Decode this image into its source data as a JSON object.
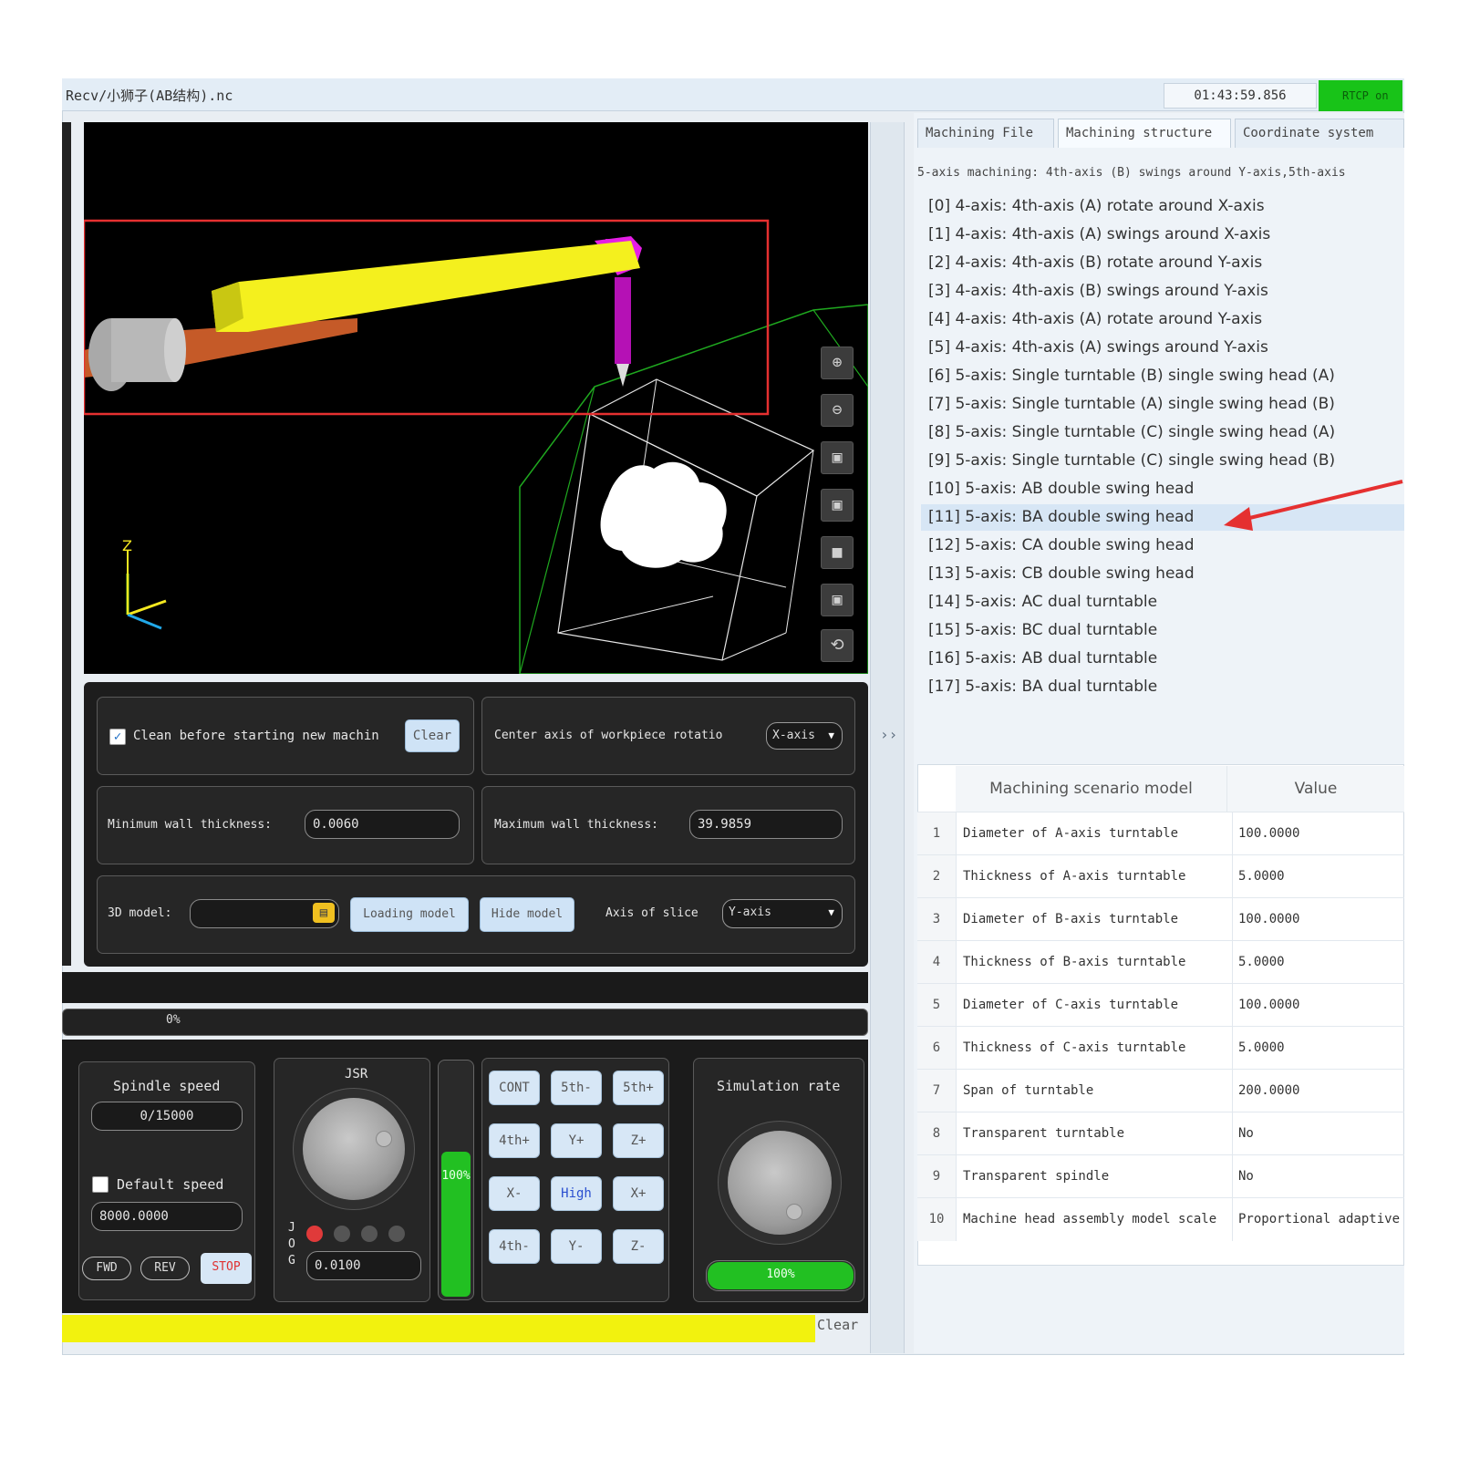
{
  "window": {
    "title": "Recv/小狮子(AB结构).nc",
    "timer": "01:43:59.856",
    "rtcp_label": "RTCP on"
  },
  "viewport": {
    "tools": [
      {
        "name": "zoom-in",
        "glyph": "⊕"
      },
      {
        "name": "zoom-out",
        "glyph": "⊖"
      },
      {
        "name": "view-iso",
        "glyph": "▣"
      },
      {
        "name": "view-front",
        "glyph": "▣"
      },
      {
        "name": "view-top",
        "glyph": "■"
      },
      {
        "name": "view-side",
        "glyph": "▣"
      },
      {
        "name": "reset-view",
        "glyph": "⟲"
      }
    ],
    "axis_label": "Z"
  },
  "controls": {
    "clean_checkbox_label": "Clean before starting new machin",
    "clean_checked": true,
    "clear_button": "Clear",
    "center_axis_label": "Center axis of workpiece rotatio",
    "center_axis_value": "X-axis",
    "min_wall_label": "Minimum wall thickness:",
    "min_wall_value": "0.0060",
    "max_wall_label": "Maximum wall thickness:",
    "max_wall_value": "39.9859",
    "model_label": "3D model:",
    "model_value": "",
    "loading_model_button": "Loading model",
    "hide_model_button": "Hide model",
    "slice_axis_label": "Axis of slice",
    "slice_axis_value": "Y-axis"
  },
  "progress": {
    "text": "0%",
    "value": 0
  },
  "spindle": {
    "title": "Spindle speed",
    "speed_value": "0/15000",
    "default_label": "Default speed",
    "default_checked": false,
    "default_value": "8000.0000",
    "fwd": "FWD",
    "rev": "REV",
    "stop": "STOP"
  },
  "jog": {
    "title": "JSR",
    "side_label_chars": [
      "J",
      "O",
      "G"
    ],
    "step_value": "0.0100",
    "feed_percent": "100%",
    "feed_level": 1.0,
    "leds": [
      "red",
      "gray",
      "gray",
      "gray"
    ]
  },
  "keypad": [
    [
      "CONT",
      "5th-",
      "5th+"
    ],
    [
      "4th+",
      "Y+",
      "Z+"
    ],
    [
      "X-",
      "High",
      "X+"
    ],
    [
      "4th-",
      "Y-",
      "Z-"
    ]
  ],
  "simulation": {
    "title": "Simulation rate",
    "rate": "100%",
    "rate_level": 1.0
  },
  "output": {
    "clear": "Clear"
  },
  "right_panel": {
    "tabs": [
      "Machining File",
      "Machining structure",
      "Coordinate system"
    ],
    "active_tab": 1,
    "description": "5-axis machining: 4th-axis (B) swings around Y-axis,5th-axis",
    "options": [
      "[0] 4-axis: 4th-axis (A) rotate around X-axis",
      "[1] 4-axis: 4th-axis (A) swings around X-axis",
      "[2] 4-axis: 4th-axis (B) rotate around Y-axis",
      "[3] 4-axis: 4th-axis (B) swings around Y-axis",
      "[4] 4-axis: 4th-axis (A) rotate around Y-axis",
      "[5] 4-axis: 4th-axis (A) swings around Y-axis",
      "[6] 5-axis: Single turntable (B) single swing head (A)",
      "[7] 5-axis: Single turntable (A) single swing head (B)",
      "[8] 5-axis: Single turntable (C) single swing head (A)",
      "[9] 5-axis: Single turntable (C) single swing head (B)",
      "[10] 5-axis: AB double swing head",
      "[11] 5-axis: BA double swing head",
      "[12] 5-axis: CA double swing head",
      "[13] 5-axis: CB double swing head",
      "[14] 5-axis: AC dual turntable",
      "[15] 5-axis: BC dual turntable",
      "[16] 5-axis: AB dual turntable",
      "[17] 5-axis: BA dual turntable"
    ],
    "selected_option": 11,
    "table": {
      "headers": [
        "Machining scenario model",
        "Value"
      ],
      "rows": [
        [
          "1",
          "Diameter of A-axis turntable",
          "100.0000"
        ],
        [
          "2",
          "Thickness of A-axis turntable",
          "5.0000"
        ],
        [
          "3",
          "Diameter of B-axis turntable",
          "100.0000"
        ],
        [
          "4",
          "Thickness of B-axis turntable",
          "5.0000"
        ],
        [
          "5",
          "Diameter of C-axis turntable",
          "100.0000"
        ],
        [
          "6",
          "Thickness of C-axis turntable",
          "5.0000"
        ],
        [
          "7",
          "Span of turntable",
          "200.0000"
        ],
        [
          "8",
          "Transparent turntable",
          "No"
        ],
        [
          "9",
          "Transparent spindle",
          "No"
        ],
        [
          "10",
          "Machine head assembly model scale",
          "Proportional adaptive"
        ]
      ]
    }
  },
  "colors": {
    "rtcp_green": "#18c318",
    "highlight_red": "#e53030",
    "feed_green": "#22c022",
    "stop_red": "#e03030",
    "output_yellow": "#f2f20e"
  }
}
